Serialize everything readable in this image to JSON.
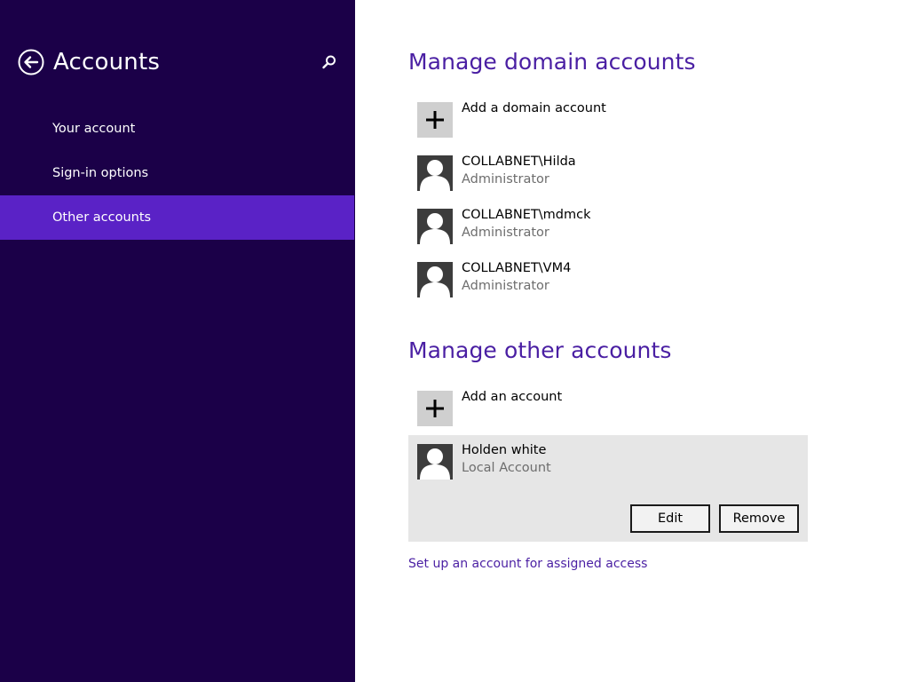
{
  "sidebar": {
    "title": "Accounts",
    "back_icon": "back-arrow-icon",
    "search_icon": "search-icon",
    "items": [
      {
        "label": "Your account",
        "selected": false
      },
      {
        "label": "Sign-in options",
        "selected": false
      },
      {
        "label": "Other accounts",
        "selected": true
      }
    ],
    "colors": {
      "background": "#1b0048",
      "selected": "#5a22c6"
    }
  },
  "main": {
    "domain_section": {
      "title": "Manage domain accounts",
      "add_label": "Add a domain account",
      "accounts": [
        {
          "name": "COLLABNET\\Hilda",
          "role": "Administrator"
        },
        {
          "name": "COLLABNET\\mdmck",
          "role": "Administrator"
        },
        {
          "name": "COLLABNET\\VM4",
          "role": "Administrator"
        }
      ]
    },
    "other_section": {
      "title": "Manage other accounts",
      "add_label": "Add an account",
      "selected_account": {
        "name": "Holden white",
        "role": "Local Account",
        "edit_label": "Edit",
        "remove_label": "Remove"
      }
    },
    "assigned_access_link": "Set up an account for assigned access",
    "colors": {
      "accent": "#4a1fa3",
      "tile": "#cfcfcf",
      "avatar": "#3c3c3c",
      "card": "#e6e6e6"
    }
  }
}
